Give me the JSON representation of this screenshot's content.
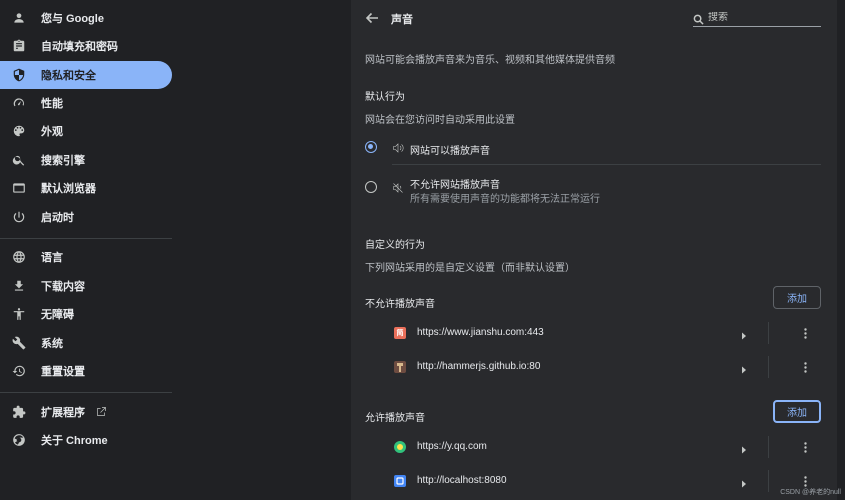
{
  "sidebar": {
    "items": [
      {
        "label": "您与 Google",
        "icon": "person-icon"
      },
      {
        "label": "自动填充和密码",
        "icon": "clipboard-icon"
      },
      {
        "label": "隐私和安全",
        "icon": "shield-icon"
      },
      {
        "label": "性能",
        "icon": "speedometer-icon"
      },
      {
        "label": "外观",
        "icon": "palette-icon"
      },
      {
        "label": "搜索引擎",
        "icon": "search-icon"
      },
      {
        "label": "默认浏览器",
        "icon": "browser-icon"
      },
      {
        "label": "启动时",
        "icon": "power-icon"
      },
      {
        "label": "语言",
        "icon": "globe-icon"
      },
      {
        "label": "下载内容",
        "icon": "download-icon"
      },
      {
        "label": "无障碍",
        "icon": "accessibility-icon"
      },
      {
        "label": "系统",
        "icon": "wrench-icon"
      },
      {
        "label": "重置设置",
        "icon": "reset-icon"
      },
      {
        "label": "扩展程序",
        "icon": "puzzle-icon"
      },
      {
        "label": "关于 Chrome",
        "icon": "chrome-icon"
      }
    ],
    "active_index": 2
  },
  "header": {
    "title": "声音",
    "search_placeholder": "搜索"
  },
  "main": {
    "description": "网站可能会播放声音来为音乐、视频和其他媒体提供音频",
    "default_behavior": {
      "title": "默认行为",
      "subtitle": "网站会在您访问时自动采用此设置",
      "options": [
        {
          "label": "网站可以播放声音",
          "sublabel": "",
          "checked": true
        },
        {
          "label": "不允许网站播放声音",
          "sublabel": "所有需要使用声音的功能都将无法正常运行",
          "checked": false
        }
      ]
    },
    "custom_behavior": {
      "title": "自定义的行为",
      "subtitle": "下列网站采用的是自定义设置（而非默认设置）"
    },
    "blocked": {
      "title": "不允许播放声音",
      "add_label": "添加",
      "sites": [
        {
          "url": "https://www.jianshu.com:443",
          "favicon_text": "简",
          "favicon_color": "#ea6f5a"
        },
        {
          "url": "http://hammerjs.github.io:80",
          "favicon_text": "",
          "favicon_color": "#8d6e63"
        }
      ]
    },
    "allowed": {
      "title": "允许播放声音",
      "add_label": "添加",
      "sites": [
        {
          "url": "https://y.qq.com",
          "favicon_text": "",
          "favicon_color": "#31c27c"
        },
        {
          "url": "http://localhost:8080",
          "favicon_text": "",
          "favicon_color": "#4285f4"
        }
      ]
    }
  },
  "watermark": "CSDN @养老的null",
  "colors": {
    "accent": "#8ab4f8",
    "background": "#202124",
    "panel": "#292a2d"
  }
}
